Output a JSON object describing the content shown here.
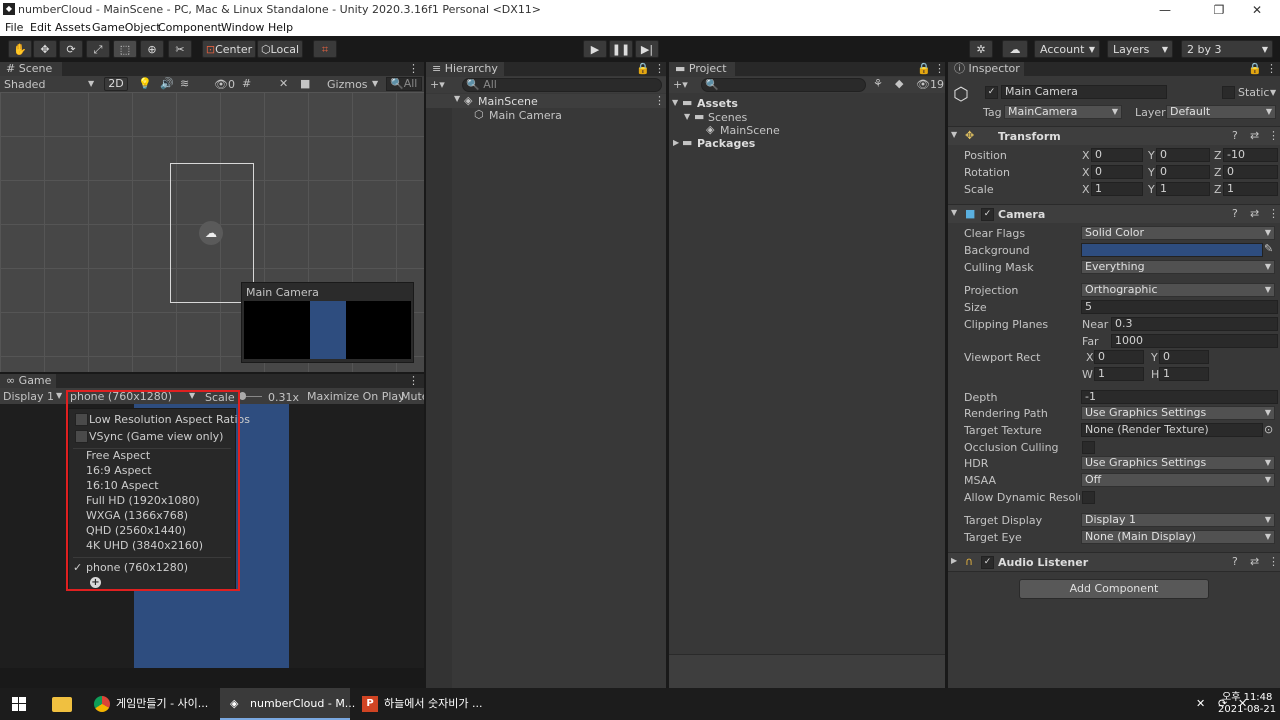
{
  "window": {
    "title": "numberCloud - MainScene - PC, Mac & Linux Standalone - Unity 2020.3.16f1 Personal <DX11>"
  },
  "menu": [
    "File",
    "Edit",
    "Assets",
    "GameObject",
    "Component",
    "Window",
    "Help"
  ],
  "toolbar": {
    "center": "Center",
    "local": "Local",
    "account": "Account",
    "layers": "Layers",
    "layout": "2 by 3"
  },
  "scene": {
    "tab": "Scene",
    "shading": "Shaded",
    "mode_2d": "2D",
    "hidden_count": "0",
    "gizmos": "Gizmos",
    "search_placeholder": "All",
    "preview_title": "Main Camera"
  },
  "game": {
    "tab": "Game",
    "display": "Display 1",
    "resolution": "phone (760x1280)",
    "scale_label": "Scale",
    "scale_value": "0.31x",
    "maximize": "Maximize On Play",
    "mute": "Mute",
    "menu": {
      "low_res": "Low Resolution Aspect Ratios",
      "vsync": "VSync (Game view only)",
      "items": [
        "Free Aspect",
        "16:9 Aspect",
        "16:10 Aspect",
        "Full HD (1920x1080)",
        "WXGA (1366x768)",
        "QHD (2560x1440)",
        "4K UHD (3840x2160)"
      ],
      "selected": "phone (760x1280)",
      "check": "✓"
    }
  },
  "hierarchy": {
    "tab": "Hierarchy",
    "search_placeholder": "All",
    "scene": "MainScene",
    "child": "Main Camera"
  },
  "project": {
    "tab": "Project",
    "badge": "19",
    "assets": "Assets",
    "scenes": "Scenes",
    "mainscene": "MainScene",
    "packages": "Packages"
  },
  "inspector": {
    "tab": "Inspector",
    "object_name": "Main Camera",
    "static": "Static",
    "tag_label": "Tag",
    "tag_value": "MainCamera",
    "layer_label": "Layer",
    "layer_value": "Default",
    "transform": {
      "title": "Transform",
      "position": "Position",
      "rotation": "Rotation",
      "scale": "Scale",
      "px": "0",
      "py": "0",
      "pz": "-10",
      "rx": "0",
      "ry": "0",
      "rz": "0",
      "sx": "1",
      "sy": "1",
      "sz": "1"
    },
    "camera": {
      "title": "Camera",
      "clear_flags": "Clear Flags",
      "clear_flags_value": "Solid Color",
      "background": "Background",
      "background_color": "#2e4d7f",
      "culling_mask": "Culling Mask",
      "culling_mask_value": "Everything",
      "projection": "Projection",
      "projection_value": "Orthographic",
      "size": "Size",
      "size_value": "5",
      "clipping": "Clipping Planes",
      "near": "Near",
      "near_value": "0.3",
      "far": "Far",
      "far_value": "1000",
      "viewport": "Viewport Rect",
      "vx": "0",
      "vy": "0",
      "vw": "1",
      "vh": "1",
      "depth": "Depth",
      "depth_value": "-1",
      "rendering_path": "Rendering Path",
      "rendering_path_value": "Use Graphics Settings",
      "target_texture": "Target Texture",
      "target_texture_value": "None (Render Texture)",
      "occlusion": "Occlusion Culling",
      "hdr": "HDR",
      "hdr_value": "Use Graphics Settings",
      "msaa": "MSAA",
      "msaa_value": "Off",
      "dynamic_res": "Allow Dynamic Resolutio",
      "target_display": "Target Display",
      "target_display_value": "Display 1",
      "target_eye": "Target Eye",
      "target_eye_value": "None (Main Display)"
    },
    "audio_listener": "Audio Listener",
    "add_component": "Add Component"
  },
  "taskbar": {
    "items": [
      "게임만들기 - 사이...",
      "numberCloud - M...",
      "하늘에서 숫자비가 ..."
    ],
    "time": "오후 11:48",
    "date": "2021-08-21"
  }
}
